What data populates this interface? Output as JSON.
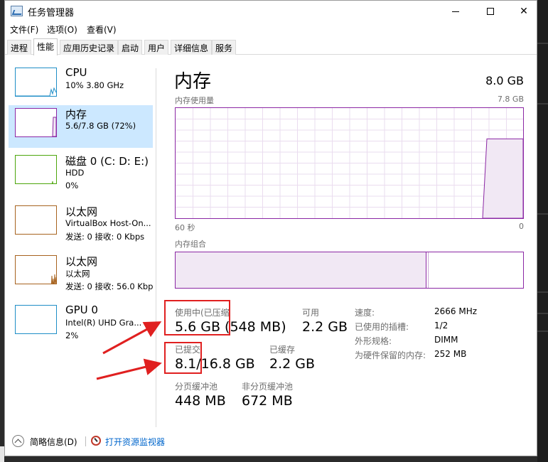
{
  "window": {
    "title": "任务管理器",
    "close_glyph": "✕"
  },
  "menu": [
    "文件(F)",
    "选项(O)",
    "查看(V)"
  ],
  "tabs": [
    "进程",
    "性能",
    "应用历史记录",
    "启动",
    "用户",
    "详细信息",
    "服务"
  ],
  "active_tab_index": 1,
  "sidebar": [
    {
      "title": "CPU",
      "line1": "10% 3.80 GHz",
      "line2": "",
      "color": "#1f8ec7"
    },
    {
      "title": "内存",
      "line1": "5.6/7.8 GB (72%)",
      "line2": "",
      "color": "#8b27a4"
    },
    {
      "title": "磁盘 0 (C: D: E:)",
      "line1": "HDD",
      "line2": "0%",
      "color": "#4da60c"
    },
    {
      "title": "以太网",
      "line1": "VirtualBox Host-On...",
      "line2": "发送: 0 接收: 0 Kbps",
      "color": "#a7631f"
    },
    {
      "title": "以太网",
      "line1": "以太网",
      "line2": "发送: 0 接收: 56.0 Kbp",
      "color": "#a7631f"
    },
    {
      "title": "GPU 0",
      "line1": "Intel(R) UHD Gra...",
      "line2": "2%",
      "color": "#1f8ec7"
    }
  ],
  "main": {
    "title": "内存",
    "total": "8.0 GB",
    "usage_label": "内存使用量",
    "usage_max": "7.8 GB",
    "time_left": "60 秒",
    "time_right": "0",
    "composition_label": "内存组合",
    "usage_fraction": 0.72
  },
  "stats": {
    "in_use_label": "使用中(已压缩",
    "in_use_value": "5.6 GB (548 MB)",
    "available_label": "可用",
    "available_value": "2.2 GB",
    "committed_label": "已提交",
    "committed_value": "8.1/16.8 GB",
    "cached_label": "已缓存",
    "cached_value": "2.2 GB",
    "paged_label": "分页缓冲池",
    "paged_value": "448 MB",
    "nonpaged_label": "非分页缓冲池",
    "nonpaged_value": "672 MB"
  },
  "specs": {
    "speed_label": "速度:",
    "speed_value": "2666 MHz",
    "slots_label": "已使用的插槽:",
    "slots_value": "1/2",
    "form_label": "外形规格:",
    "form_value": "DIMM",
    "reserved_label": "为硬件保留的内存:",
    "reserved_value": "252 MB"
  },
  "footer": {
    "less_details": "简略信息(D)",
    "resource_monitor": "打开资源监视器"
  },
  "colors": {
    "memory_accent": "#8b27a4",
    "highlight_red": "#e02020",
    "selected_bg": "#cce8ff"
  }
}
